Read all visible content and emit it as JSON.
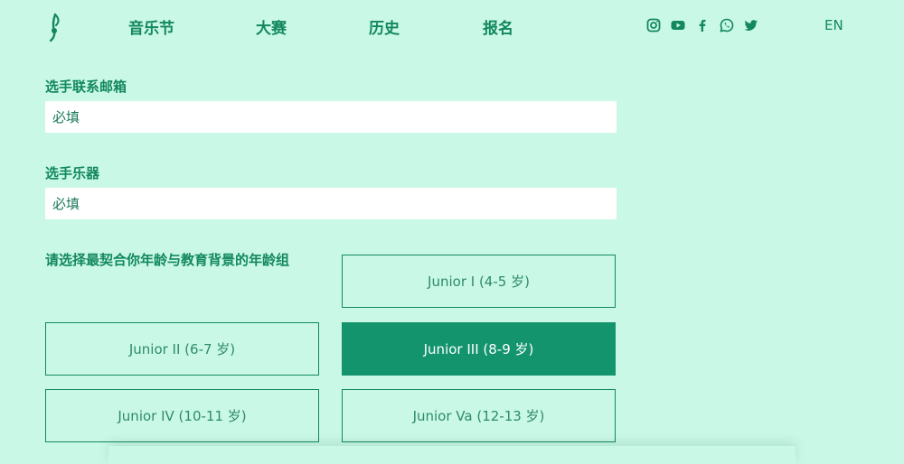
{
  "nav": {
    "items": [
      "音乐节",
      "大赛",
      "历史",
      "报名"
    ],
    "lang": "EN"
  },
  "social": [
    "instagram-icon",
    "youtube-icon",
    "facebook-icon",
    "whatsapp-icon",
    "twitter-icon"
  ],
  "form": {
    "email": {
      "label": "选手联系邮箱",
      "placeholder": "必填",
      "value": ""
    },
    "instrument": {
      "label": "选手乐器",
      "placeholder": "必填",
      "value": ""
    },
    "age_group": {
      "label": "请选择最契合你年龄与教育背景的年龄组",
      "options": [
        "Junior I (4-5 岁)",
        "Junior II (6-7 岁)",
        "Junior III (8-9 岁)",
        "Junior IV (10-11 岁)",
        "Junior Va (12-13 岁)"
      ],
      "selected": "Junior III (8-9 岁)"
    }
  },
  "colors": {
    "background": "#c9f8e6",
    "accent": "#13885f",
    "selected": "#13946d",
    "field": "#ffffff"
  }
}
